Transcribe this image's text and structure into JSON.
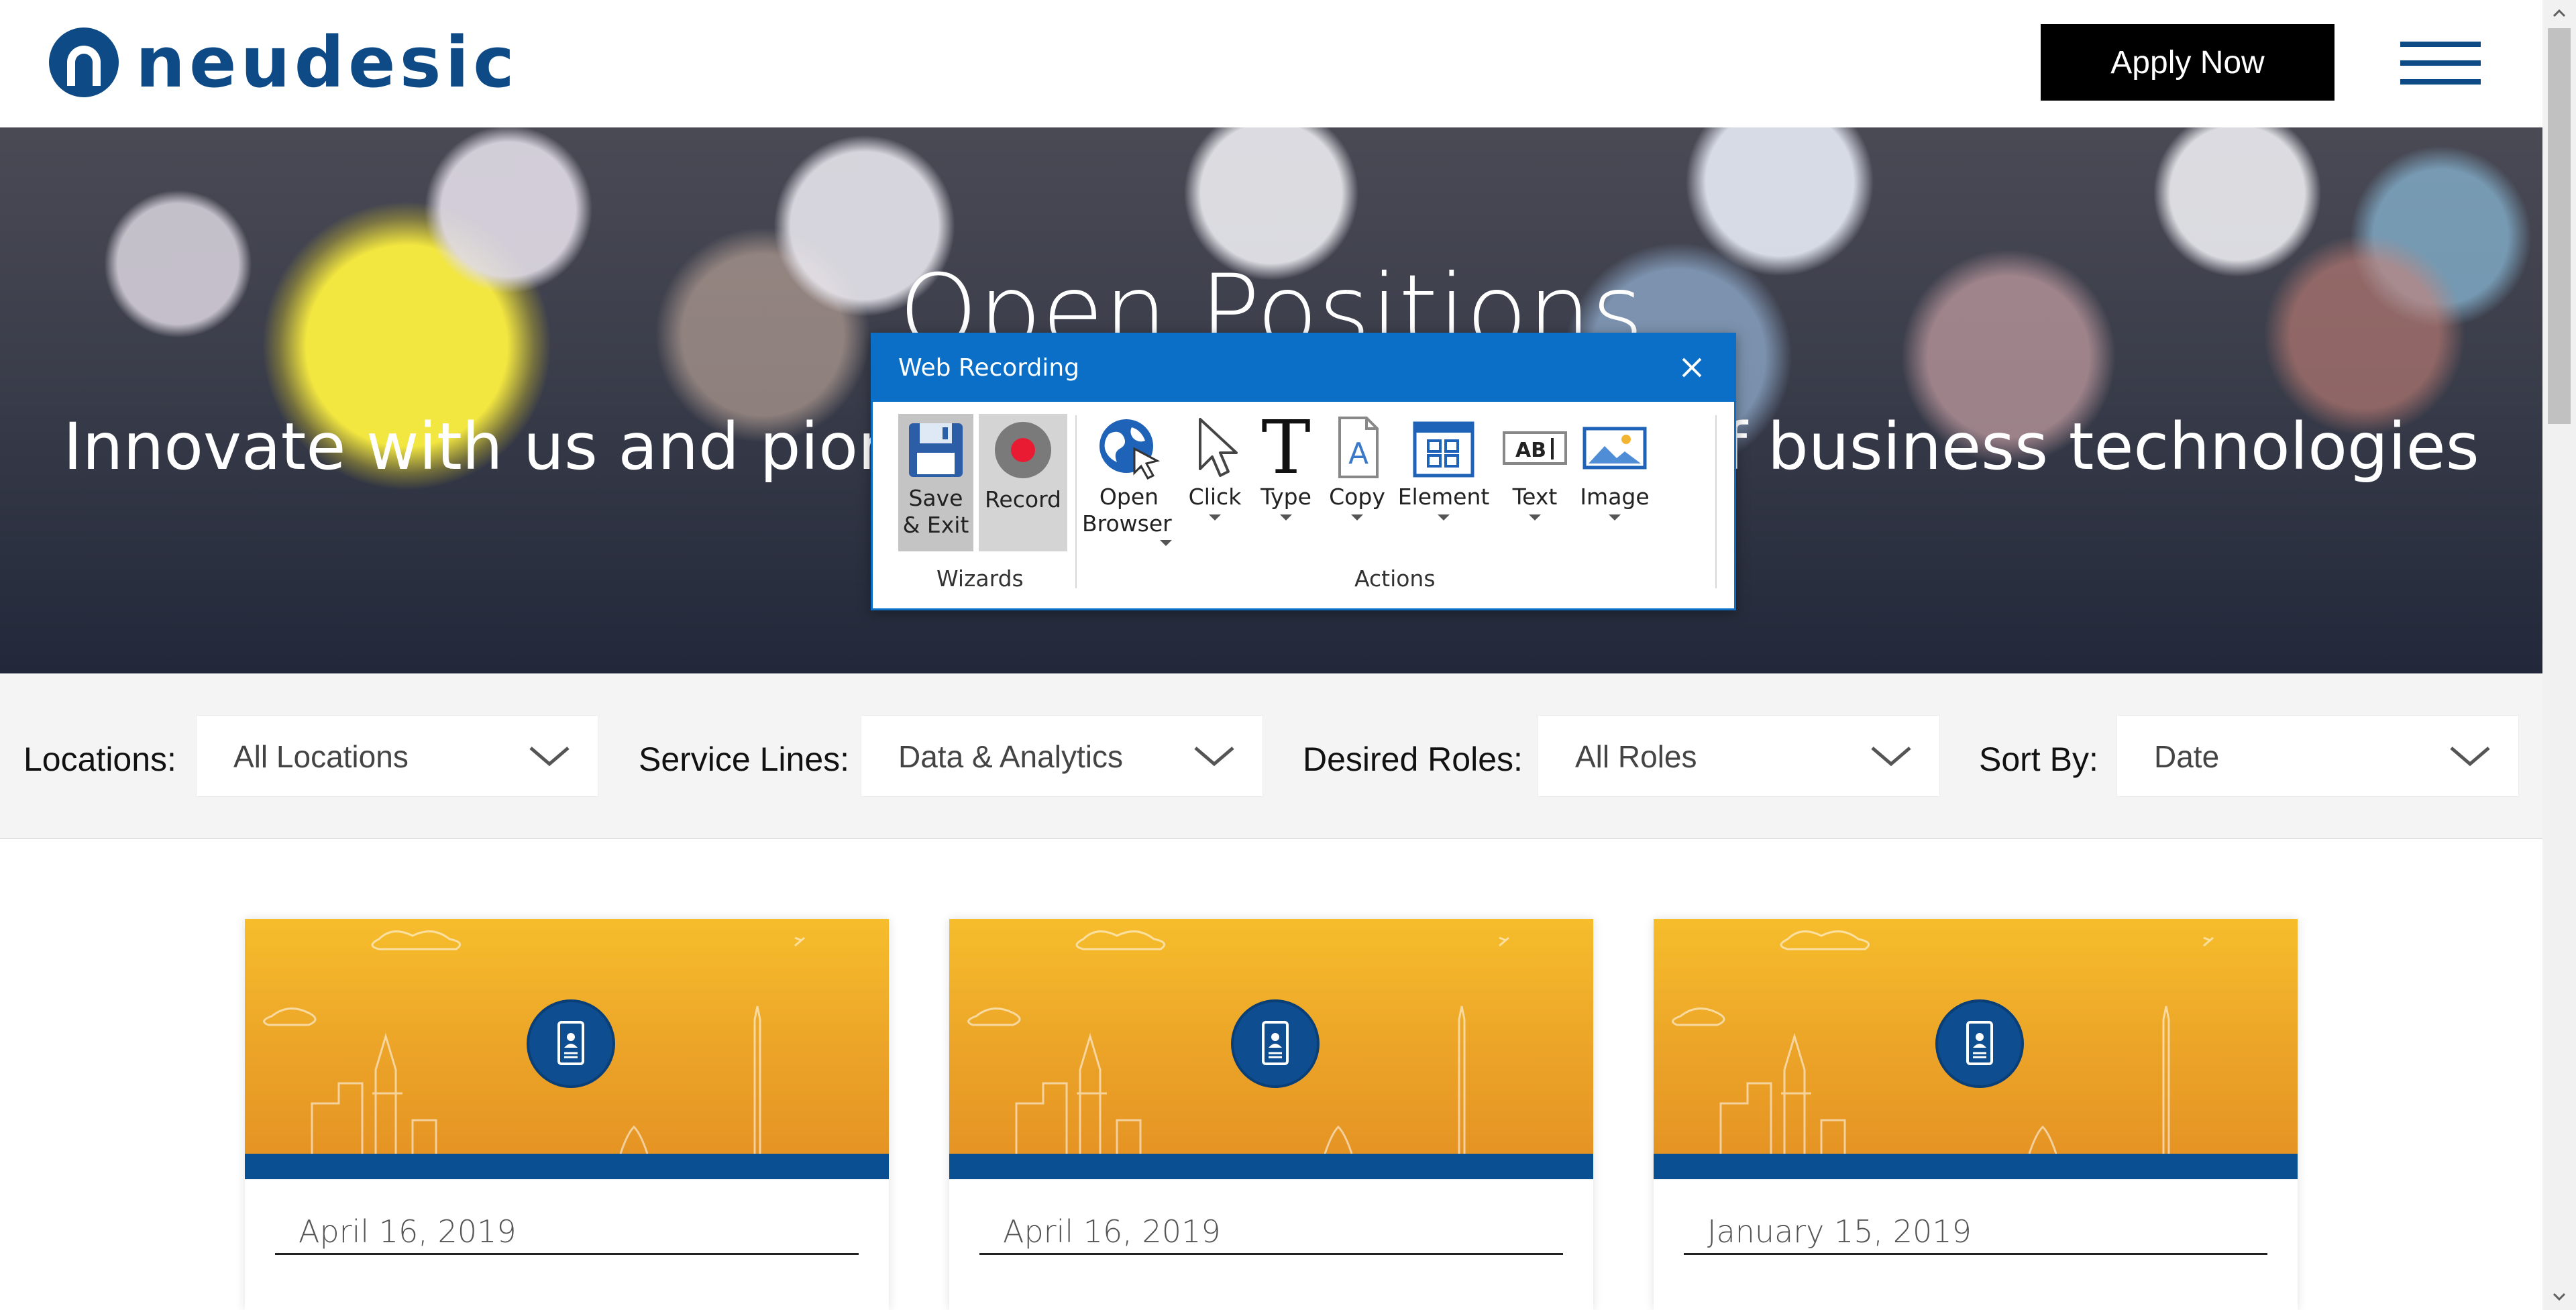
{
  "header": {
    "logo_text": "neudesic",
    "apply_label": "Apply Now",
    "brand_color": "#0e4a86"
  },
  "hero": {
    "title": "Open Positions",
    "subtitle": "Innovate with us and pioneer the next generation of business technologies"
  },
  "filters": {
    "locations": {
      "label": "Locations:",
      "value": "All Locations"
    },
    "service_lines": {
      "label": "Service Lines:",
      "value": "Data & Analytics"
    },
    "roles": {
      "label": "Desired Roles:",
      "value": "All Roles"
    },
    "sort": {
      "label": "Sort By:",
      "value": "Date"
    }
  },
  "cards": [
    {
      "date": "April 16, 2019"
    },
    {
      "date": "April 16, 2019"
    },
    {
      "date": "January 15, 2019"
    }
  ],
  "dialog": {
    "title": "Web Recording",
    "accent_color": "#0b6fc7",
    "wizards": {
      "group_label": "Wizards",
      "items": [
        {
          "label1": "Save",
          "label2": "& Exit",
          "icon": "floppy-disk-icon"
        },
        {
          "label1": "Record",
          "label2": "",
          "icon": "record-icon"
        }
      ]
    },
    "actions": {
      "group_label": "Actions",
      "items": [
        {
          "label1": "Open",
          "label2": "Browser",
          "icon": "globe-icon"
        },
        {
          "label1": "Click",
          "icon": "pointer-icon"
        },
        {
          "label1": "Type",
          "icon": "type-icon"
        },
        {
          "label1": "Copy",
          "icon": "copy-icon"
        },
        {
          "label1": "Element",
          "icon": "element-icon"
        },
        {
          "label1": "Text",
          "icon": "text-field-icon"
        },
        {
          "label1": "Image",
          "icon": "image-icon"
        }
      ]
    }
  }
}
